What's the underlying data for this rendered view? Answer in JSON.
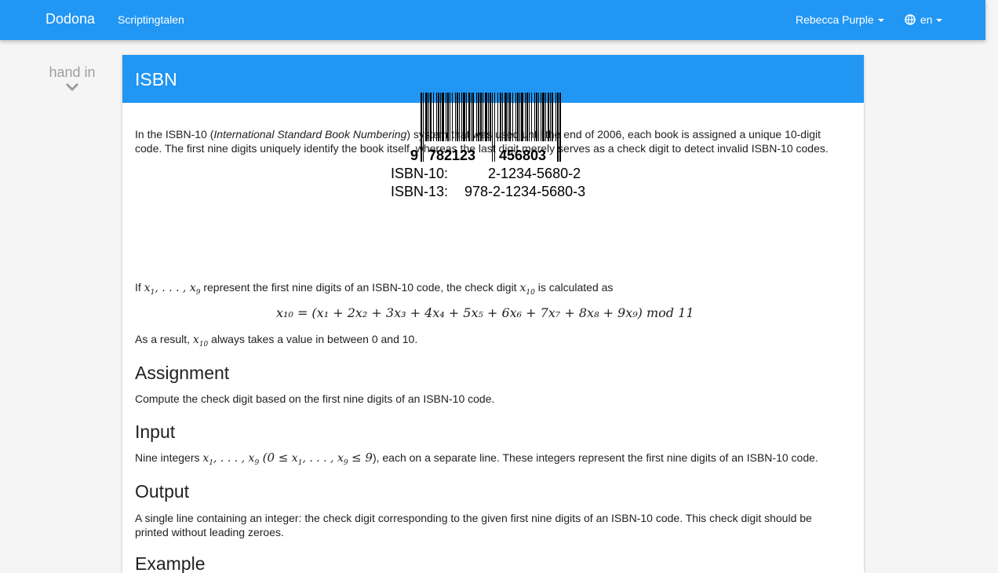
{
  "nav": {
    "brand": "Dodona",
    "course": "Scriptingtalen",
    "user": "Rebecca Purple",
    "language": "en"
  },
  "sidebar": {
    "handin": "hand in"
  },
  "exercise": {
    "title": "ISBN",
    "intro_1": "In the ISBN-10 (",
    "intro_em": "International Standard Book Numbering",
    "intro_2": ") system that was used until the end of 2006, each book is assigned a unique 10-digit code. The first nine digits uniquely identify the book itself, whereas the last digit merely serves as a check digit to detect invalid ISBN-10 codes.",
    "barcode": {
      "lead_digit": "9",
      "group_1": "782123",
      "group_2": "456803",
      "isbn10_label": "ISBN-10:",
      "isbn10_value": "2-1234-5680-2",
      "isbn13_label": "ISBN-13:",
      "isbn13_value": "978-2-1234-5680-3"
    },
    "formula_intro_1": "If",
    "formula_intro_2": "represent the first nine digits of an ISBN-10 code, the check digit",
    "formula_intro_3": "is calculated as",
    "formula": "x₁₀ = (x₁ + 2x₂ + 3x₃ + 4x₄ + 5x₅ + 6x₆ + 7x₇ + 8x₈ + 9x₉)  mod  11",
    "result_1": "As a result,",
    "result_2": "always takes a value in between 0 and 10.",
    "assignment_heading": "Assignment",
    "assignment_text": "Compute the check digit based on the first nine digits of an ISBN-10 code.",
    "input_heading": "Input",
    "input_1": "Nine integers",
    "input_2": "), each on a separate line. These integers represent the first nine digits of an ISBN-10 code.",
    "output_heading": "Output",
    "output_text": "A single line containing an integer: the check digit corresponding to the given first nine digits of an ISBN-10 code. This check digit should be printed without leading zeroes.",
    "example_heading": "Example"
  },
  "colors": {
    "primary": "#2196f3",
    "background": "#f5f5f5"
  }
}
